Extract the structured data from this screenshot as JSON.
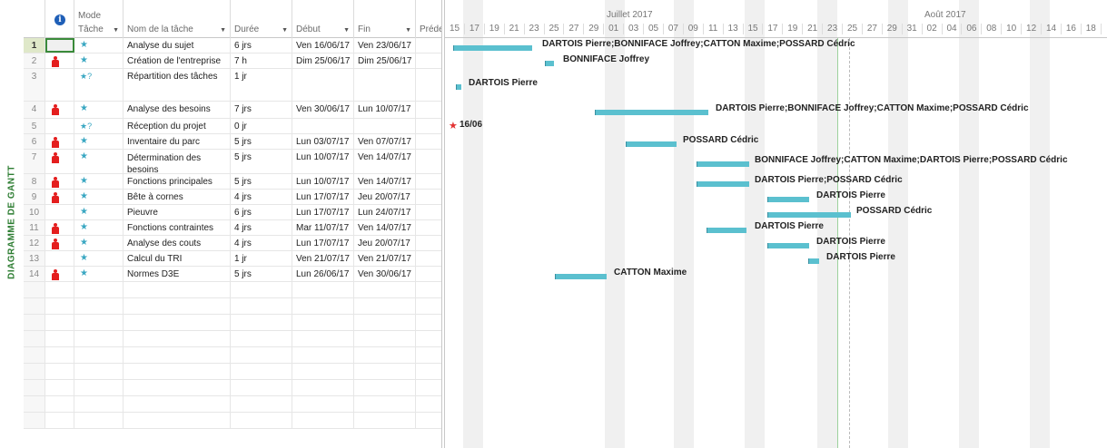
{
  "side_label": "DIAGRAMME DE GANTT",
  "columns": {
    "mode_top": "Mode",
    "mode_bottom": "Tâche",
    "name": "Nom de la tâche",
    "duration": "Durée",
    "start": "Début",
    "end": "Fin",
    "pred": "Préde"
  },
  "timeline": {
    "months": [
      "Juillet 2017",
      "Août 2017"
    ],
    "days": [
      "15",
      "17",
      "19",
      "21",
      "23",
      "25",
      "27",
      "29",
      "01",
      "03",
      "05",
      "07",
      "09",
      "11",
      "13",
      "15",
      "17",
      "19",
      "21",
      "23",
      "25",
      "27",
      "29",
      "31",
      "02",
      "04",
      "06",
      "08",
      "10",
      "12",
      "14",
      "16",
      "18"
    ]
  },
  "tasks": [
    {
      "id": "1",
      "resource_icon": false,
      "mode": "pin",
      "name": "Analyse du sujet",
      "duration": "6 jrs",
      "start": "Ven 16/06/17",
      "end": "Ven 23/06/17",
      "label": "DARTOIS Pierre;BONNIFACE Joffrey;CATTON Maxime;POSSARD Cédric"
    },
    {
      "id": "2",
      "resource_icon": true,
      "mode": "pin",
      "name": "Création de l'entreprise",
      "duration": "7 h",
      "start": "Dim 25/06/17",
      "end": "Dim 25/06/17",
      "label": "BONNIFACE Joffrey"
    },
    {
      "id": "3",
      "resource_icon": false,
      "mode": "pinq",
      "name": "Répartition des tâches",
      "duration": "1 jr",
      "start": "",
      "end": "",
      "label": "DARTOIS Pierre"
    },
    {
      "id": "4",
      "resource_icon": true,
      "mode": "pin",
      "name": "Analyse des besoins",
      "duration": "7 jrs",
      "start": "Ven 30/06/17",
      "end": "Lun 10/07/17",
      "label": "DARTOIS Pierre;BONNIFACE Joffrey;CATTON Maxime;POSSARD Cédric"
    },
    {
      "id": "5",
      "resource_icon": false,
      "mode": "pinq",
      "name": "Réception du projet",
      "duration": "0 jr",
      "start": "",
      "end": "",
      "label": "16/06"
    },
    {
      "id": "6",
      "resource_icon": true,
      "mode": "pin",
      "name": "Inventaire du parc",
      "duration": "5 jrs",
      "start": "Lun 03/07/17",
      "end": "Ven 07/07/17",
      "label": "POSSARD Cédric"
    },
    {
      "id": "7",
      "resource_icon": true,
      "mode": "pin",
      "name": "Détermination des besoins",
      "duration": "5 jrs",
      "start": "Lun 10/07/17",
      "end": "Ven 14/07/17",
      "label": "BONNIFACE Joffrey;CATTON Maxime;DARTOIS Pierre;POSSARD Cédric"
    },
    {
      "id": "8",
      "resource_icon": true,
      "mode": "pin",
      "name": "Fonctions principales",
      "duration": "5 jrs",
      "start": "Lun 10/07/17",
      "end": "Ven 14/07/17",
      "label": "DARTOIS Pierre;POSSARD Cédric"
    },
    {
      "id": "9",
      "resource_icon": true,
      "mode": "pin",
      "name": "Bête à cornes",
      "duration": "4 jrs",
      "start": "Lun 17/07/17",
      "end": "Jeu 20/07/17",
      "label": "DARTOIS Pierre"
    },
    {
      "id": "10",
      "resource_icon": false,
      "mode": "pin",
      "name": "Pieuvre",
      "duration": "6 jrs",
      "start": "Lun 17/07/17",
      "end": "Lun 24/07/17",
      "label": "POSSARD Cédric"
    },
    {
      "id": "11",
      "resource_icon": true,
      "mode": "pin",
      "name": "Fonctions contraintes",
      "duration": "4 jrs",
      "start": "Mar 11/07/17",
      "end": "Ven 14/07/17",
      "label": "DARTOIS Pierre"
    },
    {
      "id": "12",
      "resource_icon": true,
      "mode": "pin",
      "name": "Analyse des couts",
      "duration": "4 jrs",
      "start": "Lun 17/07/17",
      "end": "Jeu 20/07/17",
      "label": "DARTOIS Pierre"
    },
    {
      "id": "13",
      "resource_icon": false,
      "mode": "pin",
      "name": "Calcul du TRI",
      "duration": "1 jr",
      "start": "Ven 21/07/17",
      "end": "Ven 21/07/17",
      "label": "DARTOIS Pierre"
    },
    {
      "id": "14",
      "resource_icon": true,
      "mode": "pin",
      "name": "Normes D3E",
      "duration": "5 jrs",
      "start": "Lun 26/06/17",
      "end": "Ven 30/06/17",
      "label": "CATTON Maxime"
    }
  ],
  "colors": {
    "bar": "#5bc0cf",
    "resource_icon": "#e41e1e",
    "mode_icon": "#3aa7c2",
    "side_label": "#2d7d32",
    "milestone": "#e23030"
  }
}
